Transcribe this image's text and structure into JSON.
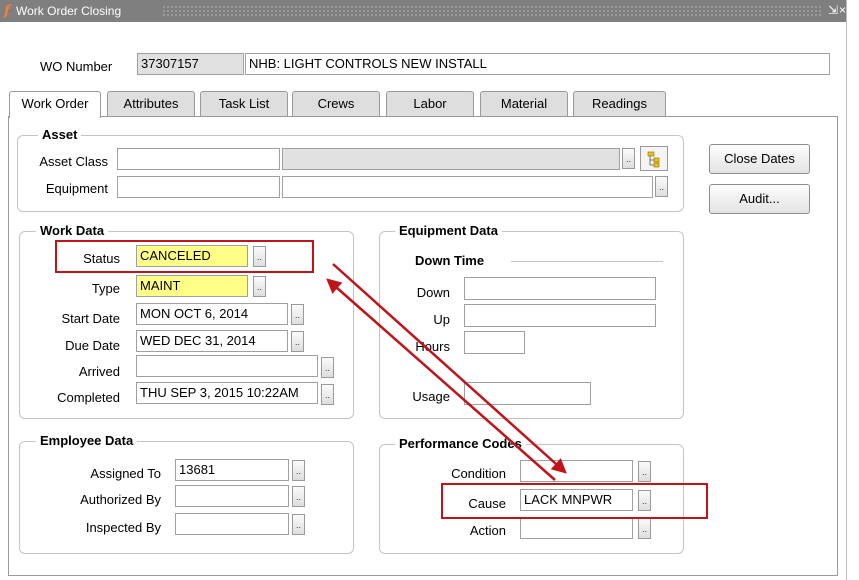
{
  "window": {
    "title": "Work Order Closing",
    "controls": [
      "⇲",
      "×"
    ]
  },
  "header": {
    "wo_label": "WO Number",
    "wo_number": "37307157",
    "wo_description": "NHB: LIGHT CONTROLS NEW INSTALL"
  },
  "tabs": [
    "Work Order",
    "Attributes",
    "Task List",
    "Crews",
    "Labor",
    "Material",
    "Readings"
  ],
  "asset": {
    "title": "Asset",
    "asset_class_label": "Asset Class",
    "asset_class_value": "",
    "asset_class_desc": "",
    "equipment_label": "Equipment",
    "equipment_value": "",
    "equipment_desc": ""
  },
  "buttons": {
    "close_dates": "Close Dates",
    "audit": "Audit..."
  },
  "work_data": {
    "title": "Work Data",
    "status_label": "Status",
    "status_value": "CANCELED",
    "type_label": "Type",
    "type_value": "MAINT",
    "start_label": "Start Date",
    "start_value": "MON OCT 6, 2014",
    "due_label": "Due Date",
    "due_value": "WED DEC 31, 2014",
    "arrived_label": "Arrived",
    "arrived_value": "",
    "completed_label": "Completed",
    "completed_value": "THU SEP 3, 2015 10:22AM"
  },
  "equipment_data": {
    "title": "Equipment Data",
    "downtime_title": "Down Time",
    "down_label": "Down",
    "up_label": "Up",
    "hours_label": "Hours",
    "usage_label": "Usage"
  },
  "employee_data": {
    "title": "Employee Data",
    "assigned_label": "Assigned To",
    "assigned_value": "13681",
    "authorized_label": "Authorized By",
    "authorized_value": "",
    "inspected_label": "Inspected By",
    "inspected_value": ""
  },
  "performance_codes": {
    "title": "Performance Codes",
    "condition_label": "Condition",
    "condition_value": "",
    "cause_label": "Cause",
    "cause_value": "LACK MNPWR",
    "action_label": "Action",
    "action_value": ""
  },
  "annotation_color": "#c0141a",
  "ui_colors": {
    "required_field": "#ffff88",
    "titlebar": "#7f7f7f",
    "app_icon": "#ff7b2e"
  }
}
